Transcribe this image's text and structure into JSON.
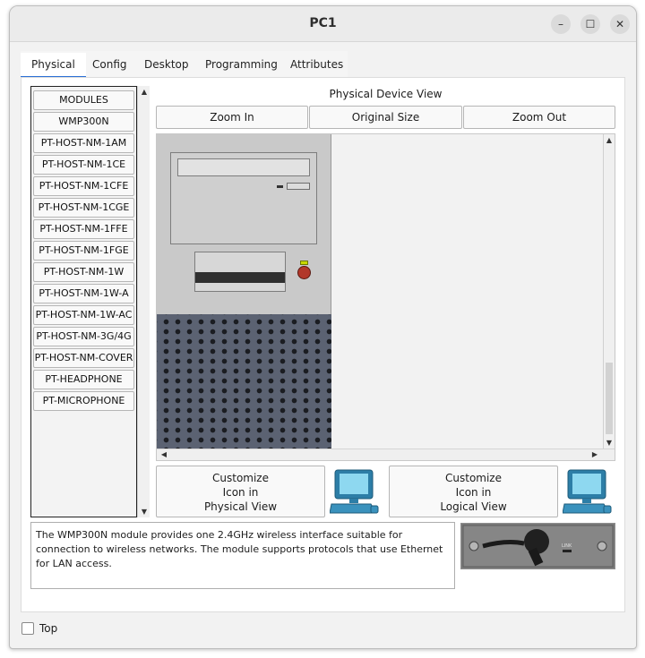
{
  "window": {
    "title": "PC1"
  },
  "window_controls": {
    "minimize": "–",
    "maximize": "☐",
    "close": "✕"
  },
  "tabs": [
    {
      "label": "Physical",
      "active": true
    },
    {
      "label": "Config"
    },
    {
      "label": "Desktop"
    },
    {
      "label": "Programming"
    },
    {
      "label": "Attributes"
    }
  ],
  "modules": [
    "MODULES",
    "WMP300N",
    "PT-HOST-NM-1AM",
    "PT-HOST-NM-1CE",
    "PT-HOST-NM-1CFE",
    "PT-HOST-NM-1CGE",
    "PT-HOST-NM-1FFE",
    "PT-HOST-NM-1FGE",
    "PT-HOST-NM-1W",
    "PT-HOST-NM-1W-A",
    "PT-HOST-NM-1W-AC",
    "PT-HOST-NM-3G/4G",
    "PT-HOST-NM-COVER",
    "PT-HEADPHONE",
    "PT-MICROPHONE"
  ],
  "physical_view": {
    "title": "Physical Device View",
    "zoom_in": "Zoom In",
    "original_size": "Original Size",
    "zoom_out": "Zoom Out"
  },
  "customize": {
    "physical": {
      "line1": "Customize",
      "line2": "Icon in",
      "line3": "Physical View"
    },
    "logical": {
      "line1": "Customize",
      "line2": "Icon in",
      "line3": "Logical View"
    }
  },
  "description": "The WMP300N module provides one 2.4GHz wireless interface suitable for connection to wireless networks. The module supports protocols that use Ethernet for LAN access.",
  "module_image": {
    "port_label": "LINK"
  },
  "footer": {
    "top_label": "Top",
    "top_checked": false
  },
  "colors": {
    "accent": "#2a6fd6",
    "pc_bottom": "#5b6272",
    "power": "#b2372a",
    "led": "#c8d800"
  }
}
